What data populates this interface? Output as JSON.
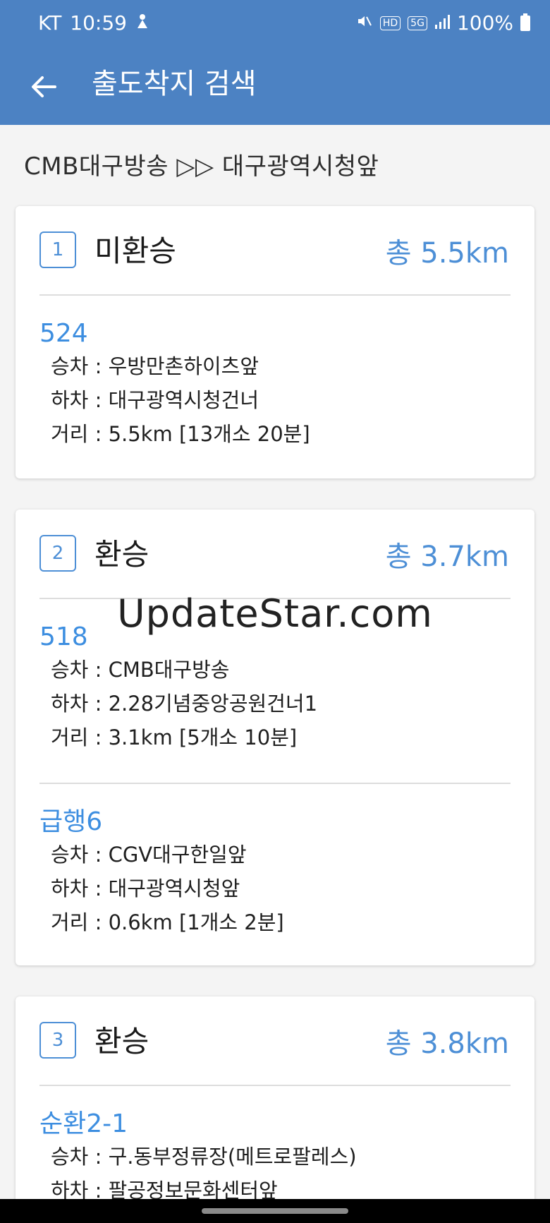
{
  "status": {
    "carrier": "KT",
    "time": "10:59",
    "battery": "100%",
    "hd_badge": "HD",
    "network": "5G"
  },
  "header": {
    "title": "출도착지 검색"
  },
  "route_summary": "CMB대구방송 ▷▷ 대구광역시청앞",
  "routes": [
    {
      "index": "1",
      "type": "미환승",
      "total": "총 5.5km",
      "segments": [
        {
          "bus": "524",
          "board": "승차 : 우방만촌하이츠앞",
          "alight": "하차 : 대구광역시청건너",
          "distance": "거리 : 5.5km [13개소 20분]"
        }
      ]
    },
    {
      "index": "2",
      "type": "환승",
      "total": "총 3.7km",
      "segments": [
        {
          "bus": "518",
          "board": "승차 : CMB대구방송",
          "alight": "하차 : 2.28기념중앙공원건너1",
          "distance": "거리 : 3.1km [5개소 10분]"
        },
        {
          "bus": "급행6",
          "board": "승차 : CGV대구한일앞",
          "alight": "하차 : 대구광역시청앞",
          "distance": "거리 : 0.6km [1개소 2분]"
        }
      ]
    },
    {
      "index": "3",
      "type": "환승",
      "total": "총 3.8km",
      "segments": [
        {
          "bus": "순환2-1",
          "board": "승차 : 구.동부정류장(메트로팔레스)",
          "alight": "하차 : 팔공정보문화센터앞"
        }
      ]
    }
  ],
  "watermark": "UpdateStar.com"
}
